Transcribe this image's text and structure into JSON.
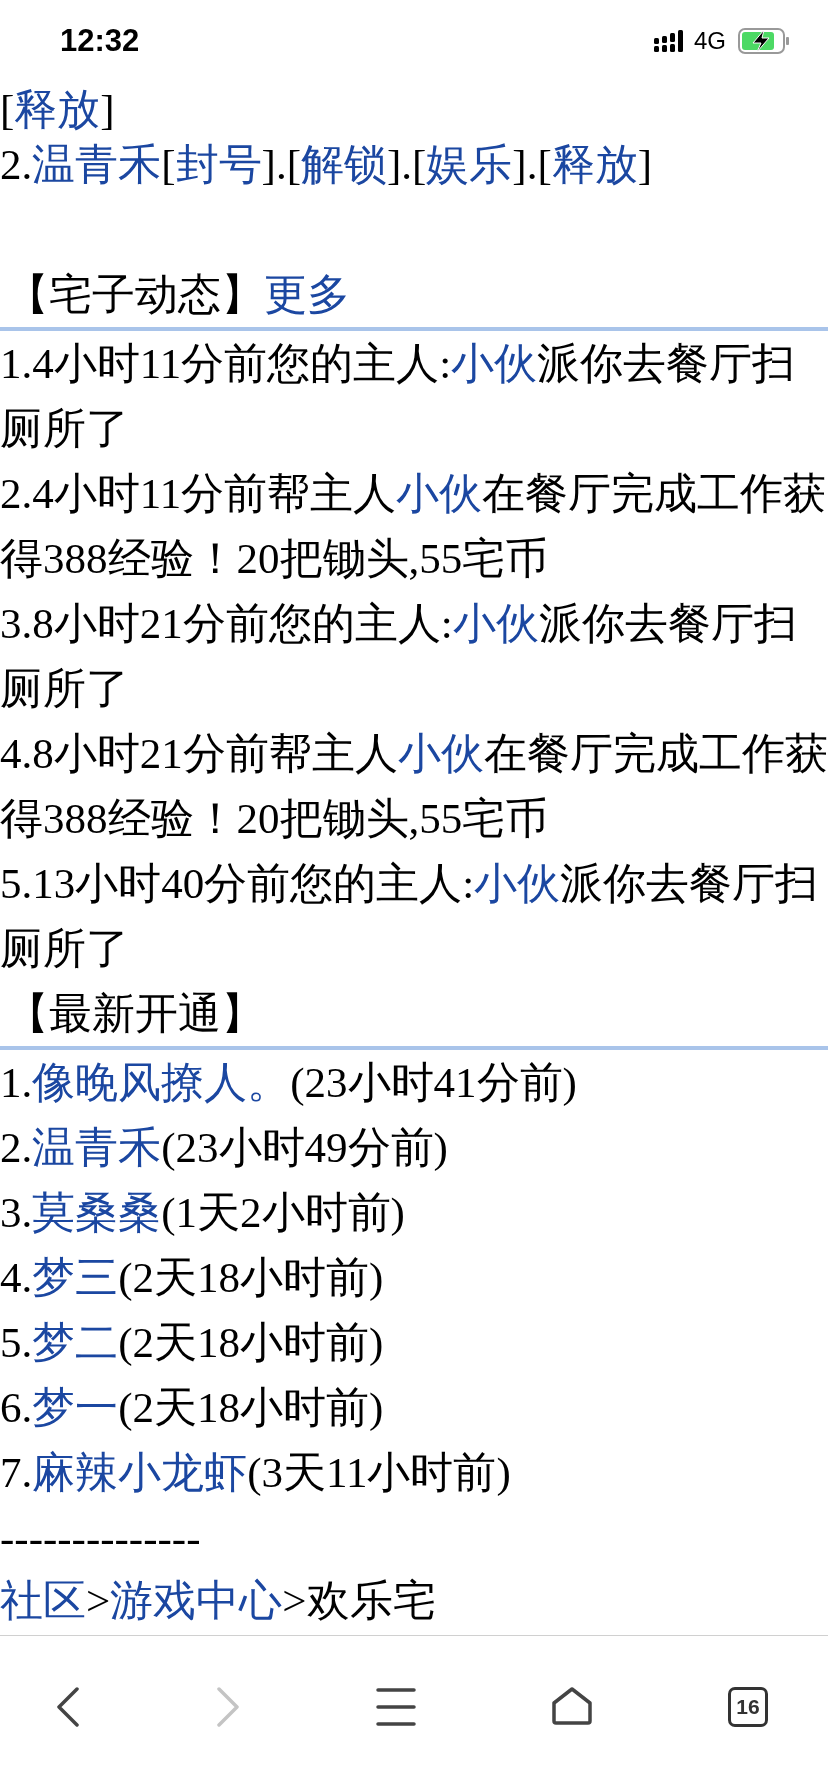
{
  "status_bar": {
    "time": "12:32",
    "network": "4G"
  },
  "top_lines": [
    [
      {
        "kind": "text",
        "text": "["
      },
      {
        "kind": "link",
        "text": "释放"
      },
      {
        "kind": "text",
        "text": "]"
      }
    ],
    [
      {
        "kind": "text",
        "text": "2."
      },
      {
        "kind": "link",
        "text": "温青禾"
      },
      {
        "kind": "text",
        "text": "["
      },
      {
        "kind": "link",
        "text": "封号"
      },
      {
        "kind": "text",
        "text": "].["
      },
      {
        "kind": "link",
        "text": "解锁"
      },
      {
        "kind": "text",
        "text": "].["
      },
      {
        "kind": "link",
        "text": "娱乐"
      },
      {
        "kind": "text",
        "text": "].["
      },
      {
        "kind": "link",
        "text": "释放"
      },
      {
        "kind": "text",
        "text": "]"
      }
    ]
  ],
  "activity": {
    "title": "【宅子动态】",
    "more": "更多",
    "entries": [
      [
        {
          "kind": "text",
          "text": "1.4小时11分前您的主人:"
        },
        {
          "kind": "link",
          "text": "小伙"
        },
        {
          "kind": "text",
          "text": "派你去餐厅扫厕所了"
        }
      ],
      [
        {
          "kind": "text",
          "text": "2.4小时11分前帮主人"
        },
        {
          "kind": "link",
          "text": "小伙"
        },
        {
          "kind": "text",
          "text": "在餐厅完成工作获得388经验！20把锄头,55宅币"
        }
      ],
      [
        {
          "kind": "text",
          "text": "3.8小时21分前您的主人:"
        },
        {
          "kind": "link",
          "text": "小伙"
        },
        {
          "kind": "text",
          "text": "派你去餐厅扫厕所了"
        }
      ],
      [
        {
          "kind": "text",
          "text": "4.8小时21分前帮主人"
        },
        {
          "kind": "link",
          "text": "小伙"
        },
        {
          "kind": "text",
          "text": "在餐厅完成工作获得388经验！20把锄头,55宅币"
        }
      ],
      [
        {
          "kind": "text",
          "text": "5.13小时40分前您的主人:"
        },
        {
          "kind": "link",
          "text": "小伙"
        },
        {
          "kind": "text",
          "text": "派你去餐厅扫厕所了"
        }
      ]
    ]
  },
  "newest": {
    "title": "【最新开通】",
    "entries": [
      [
        {
          "kind": "text",
          "text": "1."
        },
        {
          "kind": "link",
          "text": "像晚风撩人。"
        },
        {
          "kind": "text",
          "text": "(23小时41分前)"
        }
      ],
      [
        {
          "kind": "text",
          "text": "2."
        },
        {
          "kind": "link",
          "text": "温青禾"
        },
        {
          "kind": "text",
          "text": "(23小时49分前)"
        }
      ],
      [
        {
          "kind": "text",
          "text": "3."
        },
        {
          "kind": "link",
          "text": "莫桑桑"
        },
        {
          "kind": "text",
          "text": "(1天2小时前)"
        }
      ],
      [
        {
          "kind": "text",
          "text": "4."
        },
        {
          "kind": "link",
          "text": "梦三"
        },
        {
          "kind": "text",
          "text": "(2天18小时前)"
        }
      ],
      [
        {
          "kind": "text",
          "text": "5."
        },
        {
          "kind": "link",
          "text": "梦二"
        },
        {
          "kind": "text",
          "text": "(2天18小时前)"
        }
      ],
      [
        {
          "kind": "text",
          "text": "6."
        },
        {
          "kind": "link",
          "text": "梦一"
        },
        {
          "kind": "text",
          "text": "(2天18小时前)"
        }
      ],
      [
        {
          "kind": "text",
          "text": "7."
        },
        {
          "kind": "link",
          "text": "麻辣小龙虾"
        },
        {
          "kind": "text",
          "text": "(3天11小时前)"
        }
      ]
    ]
  },
  "separator": "--------------",
  "breadcrumb": [
    {
      "kind": "link",
      "text": "社区"
    },
    {
      "kind": "text",
      "text": ">"
    },
    {
      "kind": "link",
      "text": "游戏中心"
    },
    {
      "kind": "text",
      "text": ">欢乐宅"
    }
  ],
  "toolbar": [
    {
      "kind": "back",
      "disabled": false
    },
    {
      "kind": "forward",
      "disabled": true
    },
    {
      "kind": "menu",
      "disabled": false
    },
    {
      "kind": "home",
      "disabled": false
    },
    {
      "kind": "tabs",
      "disabled": false,
      "label": "16"
    }
  ]
}
